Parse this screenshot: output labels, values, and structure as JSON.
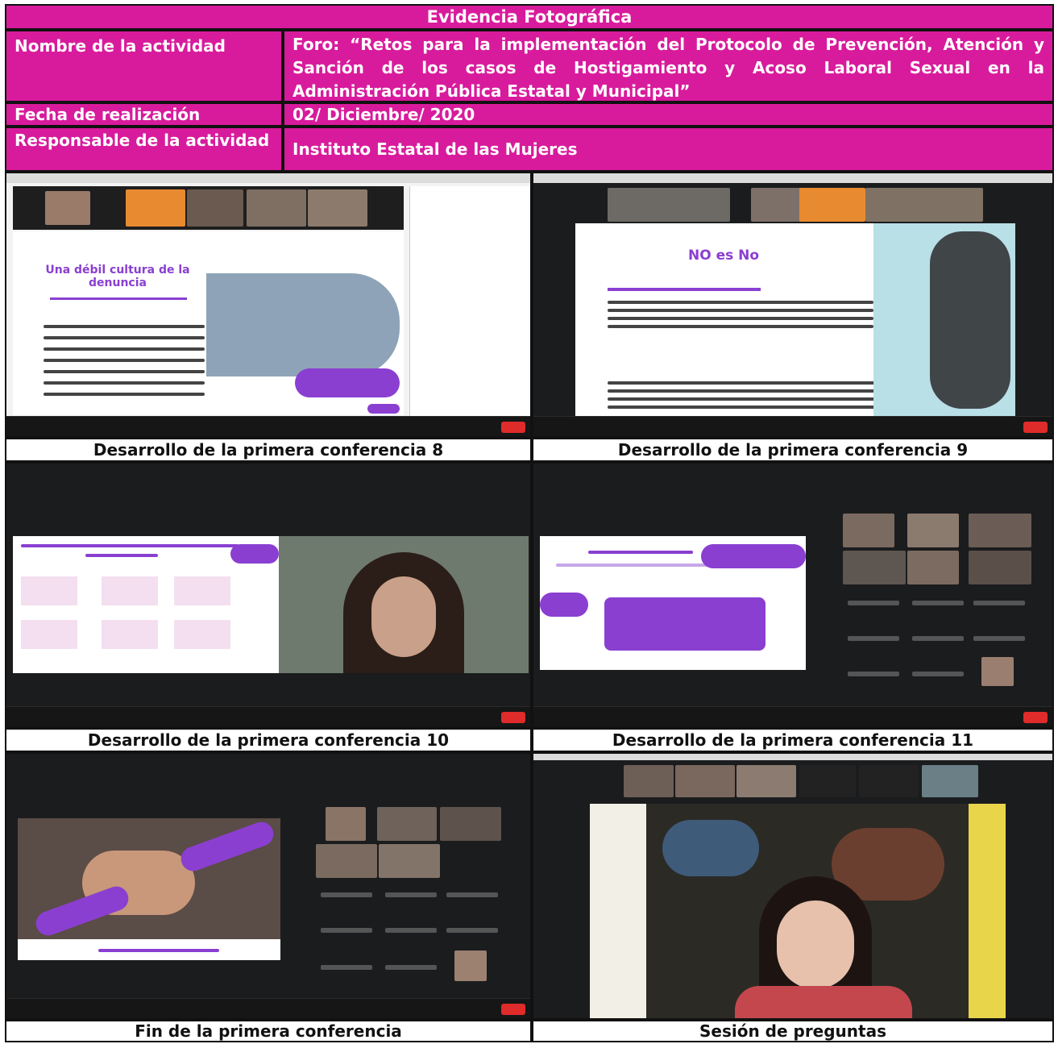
{
  "header": {
    "title": "Evidencia Fotográfica",
    "activity_label": "Nombre de la actividad",
    "activity_value": "Foro: “Retos para la implementación del Protocolo de Prevención, Atención y Sanción de los casos de Hostigamiento y Acoso Laboral Sexual en la Administración Pública Estatal y Municipal”",
    "date_label": "Fecha de realización",
    "date_value": "02/ Diciembre/ 2020",
    "responsible_label": "Responsable de la actividad",
    "responsible_value": "Instituto Estatal de las Mujeres"
  },
  "photos": [
    {
      "caption": "Desarrollo de la primera conferencia 8",
      "slide_title": "Una débil cultura de la denuncia"
    },
    {
      "caption": "Desarrollo de la primera conferencia 9",
      "slide_title": "NO es No"
    },
    {
      "caption": "Desarrollo de la primera conferencia 10"
    },
    {
      "caption": "Desarrollo de la primera conferencia 11"
    },
    {
      "caption": "Fin de la primera conferencia"
    },
    {
      "caption": "Sesión de preguntas"
    }
  ],
  "colors": {
    "header_magenta": "#d81b9c",
    "slide_purple": "#8a3fd1"
  }
}
